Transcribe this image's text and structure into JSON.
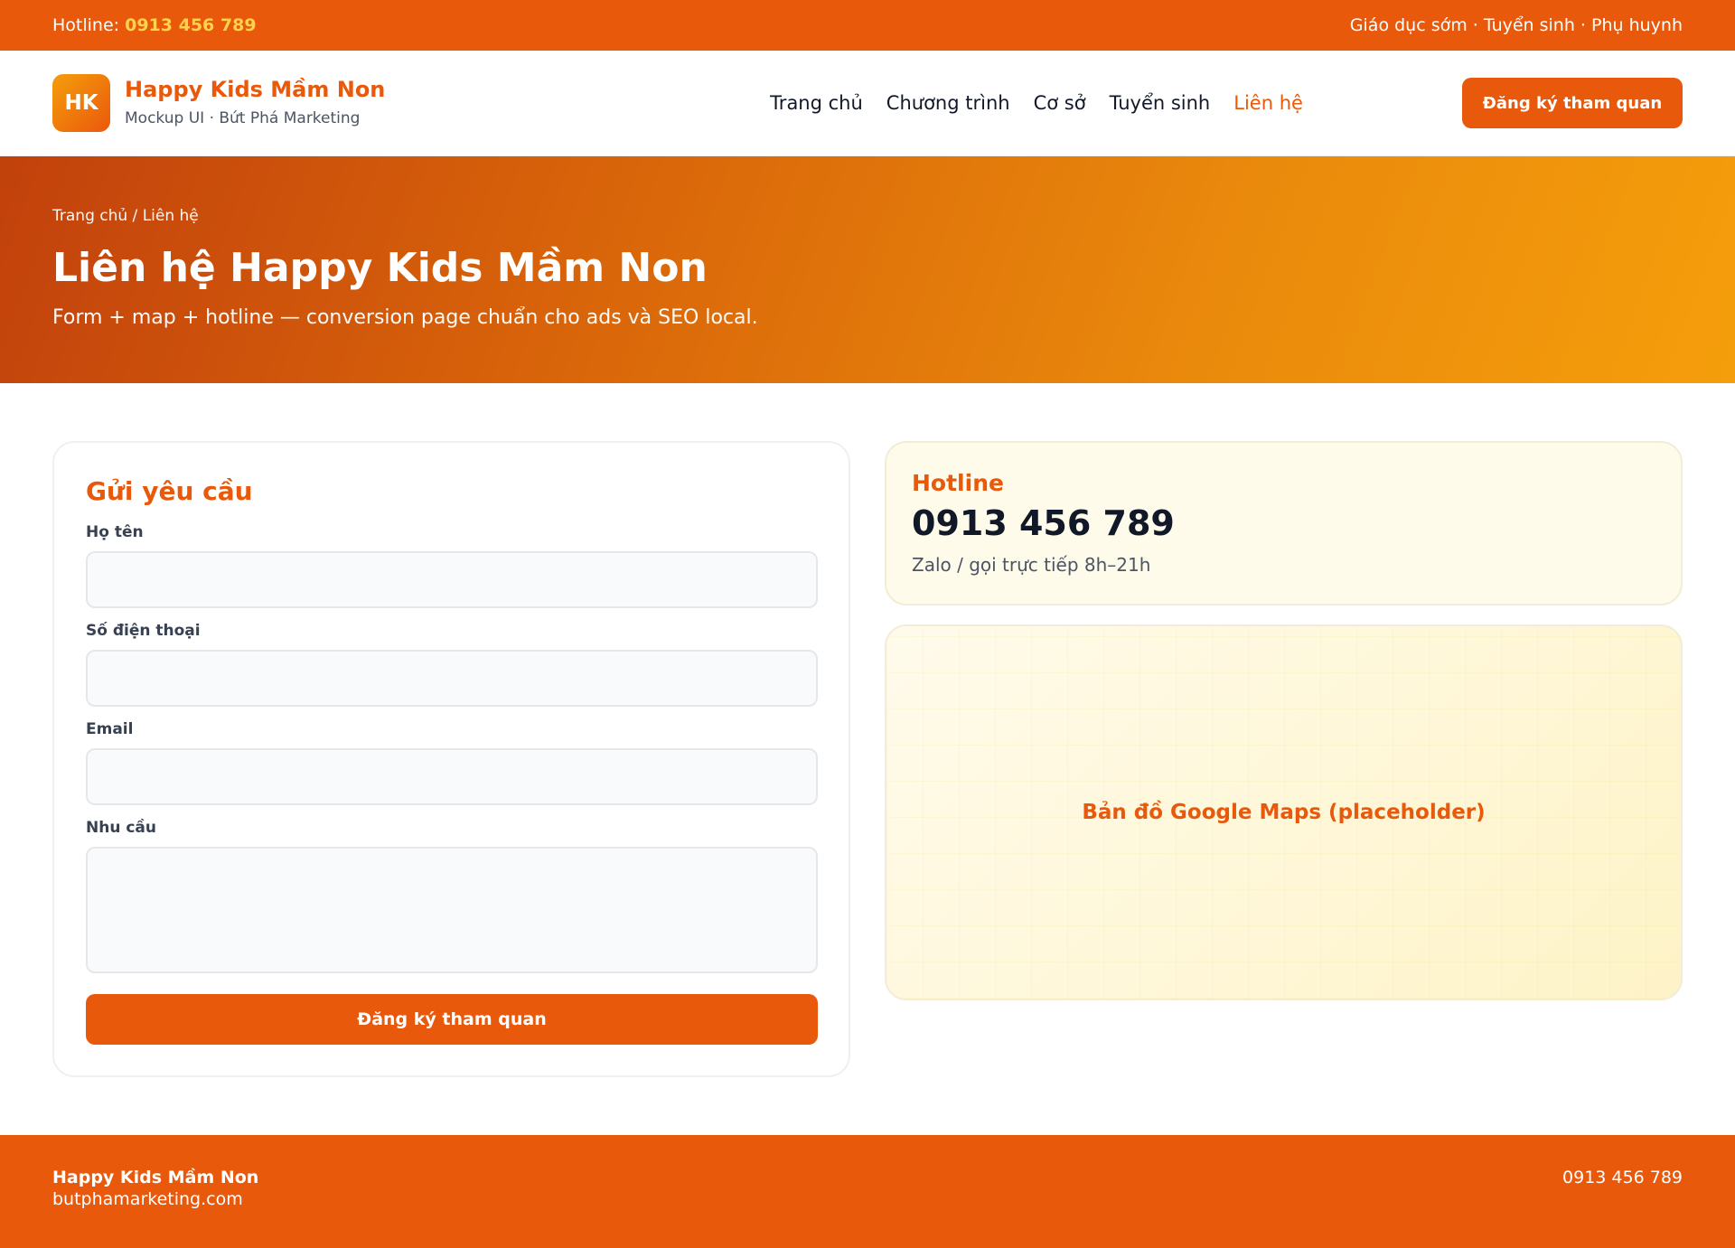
{
  "topbar": {
    "hotline_label": "Hotline:",
    "hotline_number": "0913 456 789",
    "tagline": "Giáo dục sớm · Tuyển sinh · Phụ huynh"
  },
  "header": {
    "logo_text": "HK",
    "brand_name": "Happy Kids Mầm Non",
    "brand_sub": "Mockup UI · Bứt Phá Marketing",
    "nav": [
      {
        "label": "Trang chủ"
      },
      {
        "label": "Chương trình"
      },
      {
        "label": "Cơ sở"
      },
      {
        "label": "Tuyển sinh"
      },
      {
        "label": "Liên hệ"
      }
    ],
    "active_nav": "Liên hệ",
    "cta_label": "Đăng ký tham quan"
  },
  "hero": {
    "breadcrumb": "Trang chủ / Liên hệ",
    "title": "Liên hệ Happy Kids Mầm Non",
    "lead": "Form + map + hotline — conversion page chuẩn cho ads và SEO local."
  },
  "form": {
    "title": "Gửi yêu cầu",
    "fields": [
      {
        "label": "Họ tên",
        "value": "",
        "placeholder": ""
      },
      {
        "label": "Số điện thoại",
        "value": "",
        "placeholder": ""
      },
      {
        "label": "Email",
        "value": "",
        "placeholder": ""
      },
      {
        "label": "Nhu cầu",
        "value": "",
        "placeholder": ""
      }
    ],
    "submit_label": "Đăng ký tham quan"
  },
  "hotline": {
    "label": "Hotline",
    "number": "0913 456 789",
    "note": "Zalo / gọi trực tiếp 8h–21h"
  },
  "map": {
    "placeholder_text": "Bản đồ Google Maps (placeholder)"
  },
  "footer": {
    "name": "Happy Kids Mầm Non",
    "site": "butphamarketing.com",
    "phone": "0913 456 789"
  },
  "colors": {
    "brand": "#e8590c",
    "accent_yellow": "#fcd34d",
    "hero_start": "#c2410c",
    "hero_end": "#f59e0b",
    "card_cream": "#fefbeb"
  }
}
